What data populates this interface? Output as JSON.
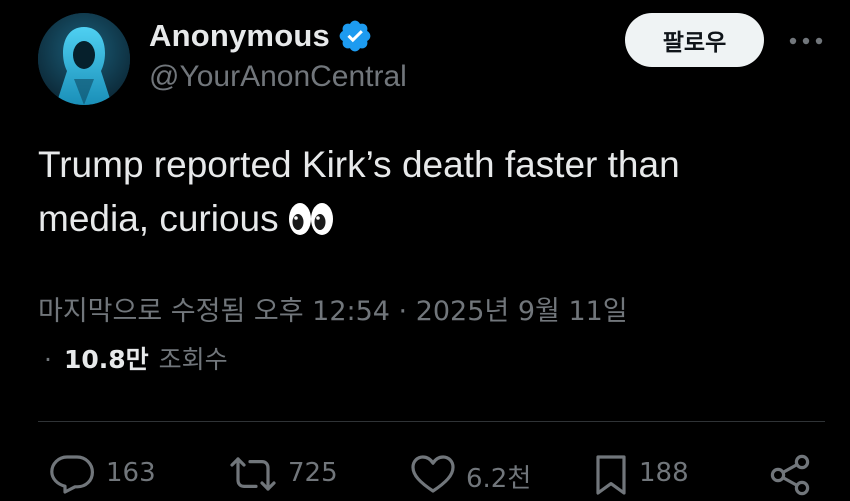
{
  "tweet": {
    "author": {
      "display_name": "Anonymous",
      "handle": "@YourAnonCentral",
      "verified": true,
      "avatar_icon": "hooded-figure-icon"
    },
    "follow_label": "팔로우",
    "more_icon": "more-dots-icon",
    "text_line1": "Trump reported Kirk’s death faster than",
    "text_line2": "media, curious",
    "emoji": "eyes-emoji",
    "meta": "마지막으로 수정됨 오후 12:54 · 2025년 9월 11일",
    "views_dot": "·",
    "views_count": "10.8만",
    "views_label": "조회수"
  },
  "actions": {
    "reply": {
      "icon": "reply-icon",
      "count": "163"
    },
    "retweet": {
      "icon": "retweet-icon",
      "count": "725"
    },
    "like": {
      "icon": "heart-icon",
      "count": "6.2천"
    },
    "bookmark": {
      "icon": "bookmark-icon",
      "count": "188"
    },
    "share": {
      "icon": "share-icon"
    }
  },
  "colors": {
    "background": "#000000",
    "primary_text": "#e7e9ea",
    "secondary_text": "#71767b",
    "verified_blue": "#1d9bf0",
    "follow_button_bg": "#eff3f4",
    "divider": "#2f3336"
  }
}
